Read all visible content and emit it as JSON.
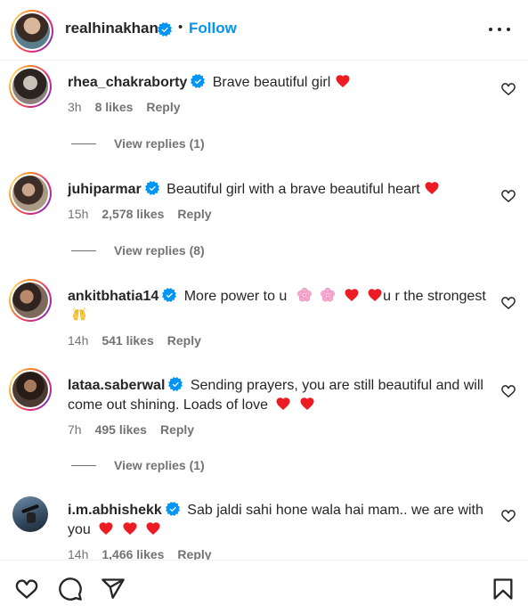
{
  "post": {
    "author": "realhinakhan",
    "follow_label": "Follow",
    "separator": "•"
  },
  "colors": {
    "verified": "#0095f6",
    "follow": "#0095f6",
    "heart": "#ed1c24",
    "muted": "#737373"
  },
  "comments": [
    {
      "user": "rhea_chakraborty",
      "text": "Brave beautiful girl",
      "emojis": [
        "red-heart"
      ],
      "time": "3h",
      "likes": "8 likes",
      "reply_label": "Reply",
      "view_replies": "View replies (1)"
    },
    {
      "user": "juhiparmar",
      "text": "Beautiful girl with a brave beautiful heart",
      "emojis": [
        "red-heart"
      ],
      "time": "15h",
      "likes": "2,578 likes",
      "reply_label": "Reply",
      "view_replies": "View replies (8)"
    },
    {
      "user": "ankitbhatia14",
      "text_a": "More power to u",
      "text_b": "u r the",
      "text_c": "strongest",
      "emojis": [
        "cherry-blossom",
        "cherry-blossom",
        "red-heart",
        "red-heart",
        "raising-hands"
      ],
      "time": "14h",
      "likes": "541 likes",
      "reply_label": "Reply"
    },
    {
      "user": "lataa.saberwal",
      "text": "Sending prayers, you are still beautiful and will come out shining. Loads of love",
      "emojis": [
        "red-heart",
        "red-heart"
      ],
      "time": "7h",
      "likes": "495 likes",
      "reply_label": "Reply",
      "view_replies": "View replies (1)"
    },
    {
      "user": "i.m.abhishekk",
      "text": "Sab jaldi sahi hone wala hai mam.. we are with you",
      "emojis": [
        "red-heart",
        "red-heart",
        "red-heart"
      ],
      "time": "14h",
      "likes": "1,466 likes",
      "reply_label": "Reply"
    }
  ],
  "icons": {
    "header_more": "more-horizontal-icon",
    "verified": "verified-badge-icon",
    "comment_like": "heart-outline-icon",
    "actions": [
      "heart-outline-icon",
      "comment-bubble-icon",
      "paper-plane-icon",
      "bookmark-icon"
    ]
  }
}
